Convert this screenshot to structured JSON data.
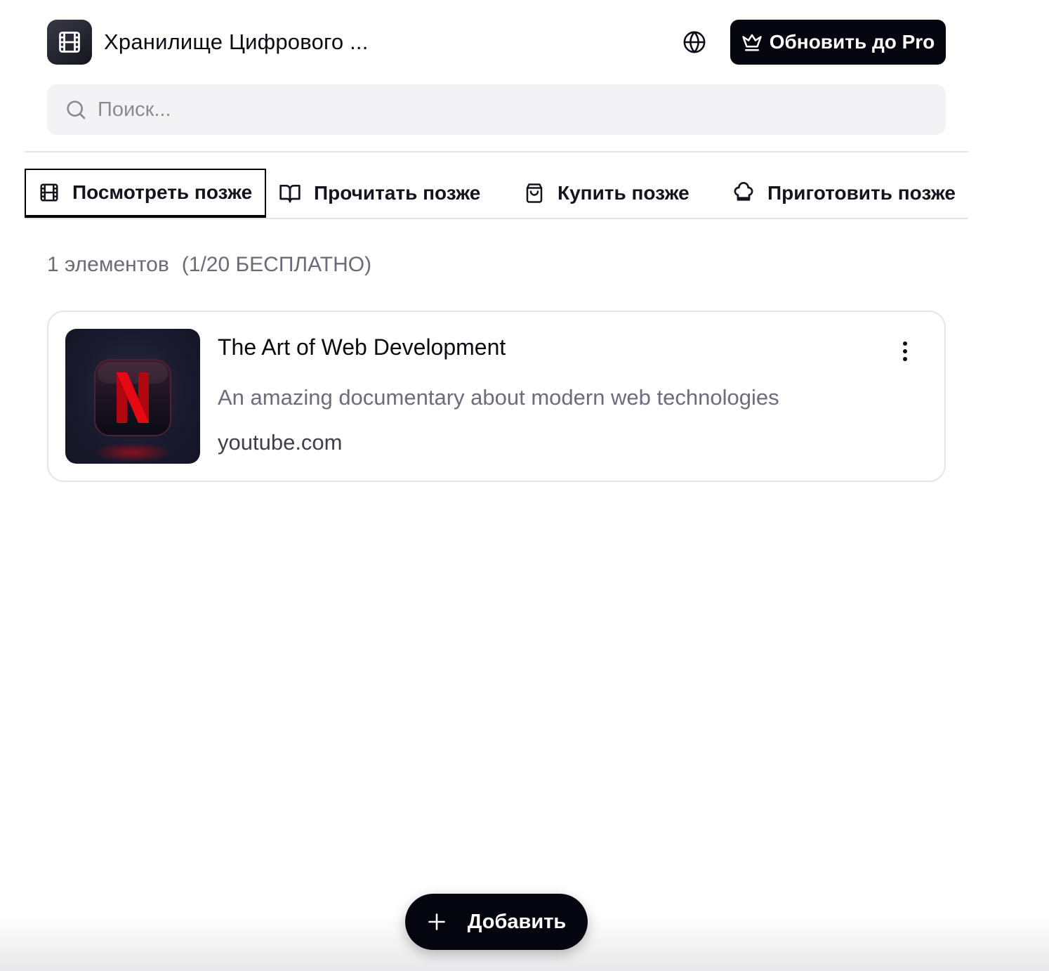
{
  "header": {
    "app_title": "Хранилище Цифрового ...",
    "upgrade_label": "Обновить до Pro"
  },
  "search": {
    "placeholder": "Поиск..."
  },
  "tabs": [
    {
      "label": "Посмотреть позже",
      "icon": "film-icon",
      "active": true
    },
    {
      "label": "Прочитать позже",
      "icon": "book-icon",
      "active": false
    },
    {
      "label": "Купить позже",
      "icon": "shopping-bag-icon",
      "active": false
    },
    {
      "label": "Приготовить позже",
      "icon": "chef-hat-icon",
      "active": false
    }
  ],
  "list": {
    "count_label": "1 элементов",
    "limit_label": "(1/20 БЕСПЛАТНО)",
    "items": [
      {
        "title": "The Art of Web Development",
        "description": "An amazing documentary about modern web technologies",
        "domain": "youtube.com",
        "thumbnail": "netflix-logo"
      }
    ]
  },
  "fab": {
    "label": "Добавить"
  },
  "colors": {
    "primary": "#05050f",
    "accent": "#e50914",
    "muted_text": "#6c6c7a",
    "search_bg": "#f3f3f5"
  }
}
